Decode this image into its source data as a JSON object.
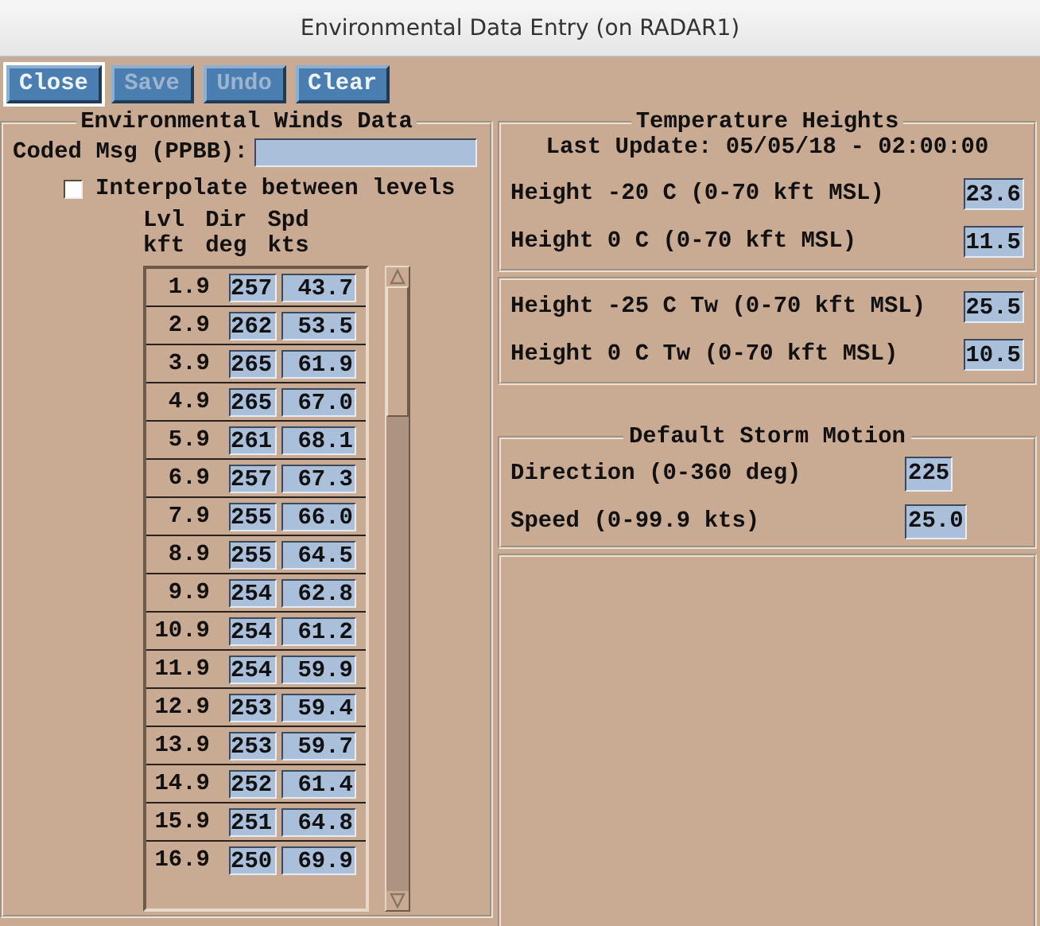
{
  "window": {
    "title": "Environmental Data Entry (on RADAR1)"
  },
  "buttons": [
    {
      "label": "Close",
      "disabled": false,
      "focused": true
    },
    {
      "label": "Save",
      "disabled": true,
      "focused": false
    },
    {
      "label": "Undo",
      "disabled": true,
      "focused": false
    },
    {
      "label": "Clear",
      "disabled": false,
      "focused": false
    }
  ],
  "winds": {
    "title": "Environmental Winds Data",
    "coded_msg_label": "Coded Msg (PPBB):",
    "interpolate_label": "Interpolate between levels",
    "interpolate_checked": false,
    "columns": [
      [
        "Lvl",
        "kft"
      ],
      [
        "Dir",
        "deg"
      ],
      [
        "Spd",
        "kts"
      ]
    ],
    "rows": [
      {
        "lvl": "1.9",
        "dir": "257",
        "spd": "43.7"
      },
      {
        "lvl": "2.9",
        "dir": "262",
        "spd": "53.5"
      },
      {
        "lvl": "3.9",
        "dir": "265",
        "spd": "61.9"
      },
      {
        "lvl": "4.9",
        "dir": "265",
        "spd": "67.0"
      },
      {
        "lvl": "5.9",
        "dir": "261",
        "spd": "68.1"
      },
      {
        "lvl": "6.9",
        "dir": "257",
        "spd": "67.3"
      },
      {
        "lvl": "7.9",
        "dir": "255",
        "spd": "66.0"
      },
      {
        "lvl": "8.9",
        "dir": "255",
        "spd": "64.5"
      },
      {
        "lvl": "9.9",
        "dir": "254",
        "spd": "62.8"
      },
      {
        "lvl": "10.9",
        "dir": "254",
        "spd": "61.2"
      },
      {
        "lvl": "11.9",
        "dir": "254",
        "spd": "59.9"
      },
      {
        "lvl": "12.9",
        "dir": "253",
        "spd": "59.4"
      },
      {
        "lvl": "13.9",
        "dir": "253",
        "spd": "59.7"
      },
      {
        "lvl": "14.9",
        "dir": "252",
        "spd": "61.4"
      },
      {
        "lvl": "15.9",
        "dir": "251",
        "spd": "64.8"
      },
      {
        "lvl": "16.9",
        "dir": "250",
        "spd": "69.9"
      }
    ]
  },
  "temperature": {
    "title": "Temperature Heights",
    "last_update": "Last Update: 05/05/18 - 02:00:00",
    "groups": [
      [
        {
          "label": "Height -20 C (0-70 kft MSL)",
          "value": "23.6"
        },
        {
          "label": "Height 0 C (0-70 kft MSL)",
          "value": "11.5"
        }
      ],
      [
        {
          "label": "Height -25 C Tw (0-70 kft MSL)",
          "value": "25.5"
        },
        {
          "label": "Height 0 C Tw (0-70 kft MSL)",
          "value": "10.5"
        }
      ]
    ]
  },
  "storm": {
    "title": "Default Storm Motion",
    "fields": [
      {
        "label": "Direction (0-360 deg)",
        "value": "225"
      },
      {
        "label": "Speed (0-99.9 kts)",
        "value": "25.0"
      }
    ]
  }
}
